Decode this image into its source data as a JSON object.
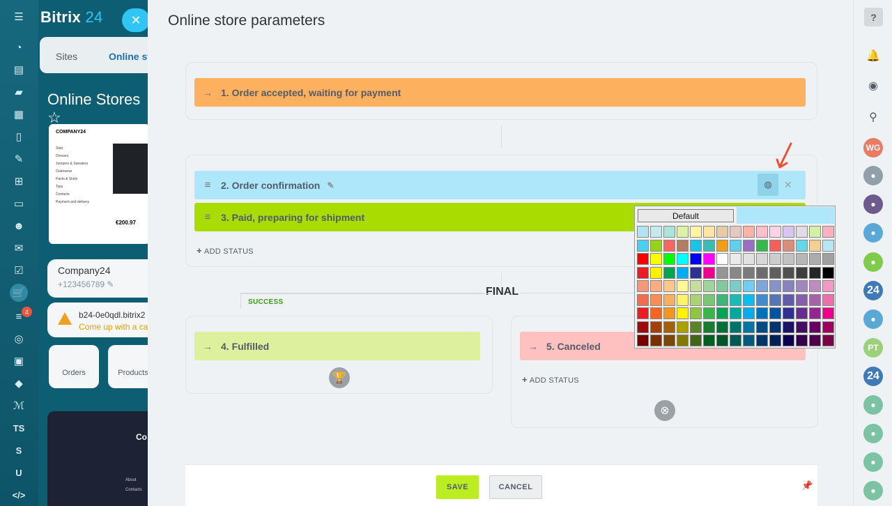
{
  "left_sidebar": {
    "icons": [
      "menu-icon",
      "activity-icon",
      "feed-icon",
      "chat-icon",
      "calendar-icon",
      "document-icon",
      "signature-icon",
      "robot-icon",
      "inbox-icon",
      "groups-icon",
      "mail-icon",
      "tasks-icon",
      "cart-icon",
      "funnel-icon",
      "target-icon",
      "contact-card-icon",
      "box-icon",
      "marketing-icon"
    ],
    "text_items": [
      "TS",
      "S",
      "U",
      "</>"
    ],
    "badge_count": "4"
  },
  "background_app": {
    "logo_main": "Bitrix",
    "logo_num": "24",
    "tabs": [
      "Sites",
      "Online st"
    ],
    "title": "Online Stores",
    "store_card": {
      "brand": "COMPANY24",
      "menu": [
        "Start",
        "Dresses",
        "Jumpers & Sweaters",
        "Outerwear",
        "Pants & Skirts",
        "Tops",
        "Contacts",
        "Payment and delivery"
      ],
      "price": "€200.97"
    },
    "company_name": "Company24",
    "company_phone": "+123456789",
    "domain": "b24-0e0qdl.bitrix2",
    "warning": "Come up with a ca",
    "mini_buttons": [
      "Orders",
      "Products"
    ],
    "dark_card": {
      "title": "Co",
      "menu": [
        "About",
        "Contacts"
      ]
    }
  },
  "slider": {
    "title": "Online store parameters",
    "statuses": [
      {
        "label": "1. Order accepted, waiting for payment",
        "color": "#fdb05e"
      },
      {
        "label": "2. Order confirmation",
        "color": "#afe7fa"
      },
      {
        "label": "3. Paid, preparing for shipment",
        "color": "#a9dc00"
      },
      {
        "label": "4. Fulfilled",
        "color": "#ddf09d"
      },
      {
        "label": "5. Canceled",
        "color": "#ffc0c0"
      }
    ],
    "add_status": "ADD STATUS",
    "final_label": "FINAL",
    "success_label": "SUCCESS",
    "save": "SAVE",
    "cancel": "CANCEL"
  },
  "color_picker": {
    "default_label": "Default",
    "preview_color": "#afe7fa",
    "rows": [
      [
        "#b0e4f0",
        "#c8e9ec",
        "#a8e6dc",
        "#dff0a8",
        "#fff4a0",
        "#fde5a6",
        "#e6cba3",
        "#e5c8c0",
        "#ffb3a7",
        "#ffc0c9",
        "#ffd3e5",
        "#d8c6f0",
        "#e2dce9",
        "#d4f0a6",
        "#ffb1c2"
      ],
      [
        "#47d1f5",
        "#94d21b",
        "#fb6460",
        "#b17e64",
        "#12c7ea",
        "#3fbbaf",
        "#f59f0e",
        "#5ed2ec",
        "#9b6ec5",
        "#35b84d",
        "#fb5d59",
        "#d98e79",
        "#62d8ec",
        "#f1d092",
        "#b6e7f4"
      ],
      [
        "#ff0000",
        "#ffff00",
        "#00ff00",
        "#00ffff",
        "#0000ff",
        "#ff00ff",
        "#ffffff",
        "#ebebeb",
        "#e1e1e1",
        "#d7d7d7",
        "#cccccc",
        "#c2c2c2",
        "#b7b7b7",
        "#acacac",
        "#a0a0a0"
      ],
      [
        "#ed1c24",
        "#fff200",
        "#00a650",
        "#00aeef",
        "#2e3192",
        "#ec008c",
        "#959595",
        "#888888",
        "#7b7b7b",
        "#6d6d6d",
        "#5f5f5f",
        "#505050",
        "#3e3e3e",
        "#262626",
        "#000000"
      ],
      [
        "#f7977a",
        "#f9ad81",
        "#fdc68a",
        "#fff79a",
        "#c4df9b",
        "#a2d39c",
        "#82ca9d",
        "#7bcdc8",
        "#6ecff6",
        "#7ea7d8",
        "#8493ca",
        "#8882be",
        "#a187be",
        "#bc8dbf",
        "#f49ac2"
      ],
      [
        "#f26c4f",
        "#f68e55",
        "#fbaf5c",
        "#fff467",
        "#acd372",
        "#7cc576",
        "#3bb878",
        "#1abbb4",
        "#00bff3",
        "#438cca",
        "#5574b9",
        "#605ca8",
        "#855fa8",
        "#a763a8",
        "#f06eaa"
      ],
      [
        "#ed1c24",
        "#f26522",
        "#f7941d",
        "#fff200",
        "#8dc63f",
        "#39b54a",
        "#00a651",
        "#00a99d",
        "#00aeef",
        "#0072bc",
        "#0054a6",
        "#2e3192",
        "#662d91",
        "#92278f",
        "#ec008c"
      ],
      [
        "#9e0b0f",
        "#a0410d",
        "#a36209",
        "#aba000",
        "#598527",
        "#1a7b30",
        "#007236",
        "#00746b",
        "#0076a3",
        "#004b80",
        "#003471",
        "#1b1464",
        "#440e62",
        "#630460",
        "#9e005d"
      ],
      [
        "#790000",
        "#7b2e00",
        "#7d4900",
        "#827b00",
        "#406618",
        "#005e20",
        "#005826",
        "#005952",
        "#005b7f",
        "#003663",
        "#002157",
        "#0d004c",
        "#32004b",
        "#4b0049",
        "#7b0046"
      ]
    ]
  },
  "right_bar": {
    "help": "?",
    "avatars": [
      {
        "initials": "WG",
        "color": "#e97b62"
      },
      {
        "initials": "",
        "color": "#8fa0a8"
      },
      {
        "initials": "",
        "color": "#6c5b8c"
      },
      {
        "initials": "",
        "color": "#59a8d6"
      },
      {
        "initials": "",
        "color": "#7fcc4d"
      },
      {
        "initials": "24",
        "color": "#3f7ab8"
      },
      {
        "initials": "",
        "color": "#59a8d6"
      },
      {
        "initials": "PT",
        "color": "#9ad179"
      },
      {
        "initials": "24",
        "color": "#3f7ab8"
      },
      {
        "initials": "",
        "color": "#7cc3a4"
      },
      {
        "initials": "",
        "color": "#7cc3a4"
      },
      {
        "initials": "",
        "color": "#7cc3a4"
      },
      {
        "initials": "",
        "color": "#7cc3a4"
      }
    ]
  }
}
